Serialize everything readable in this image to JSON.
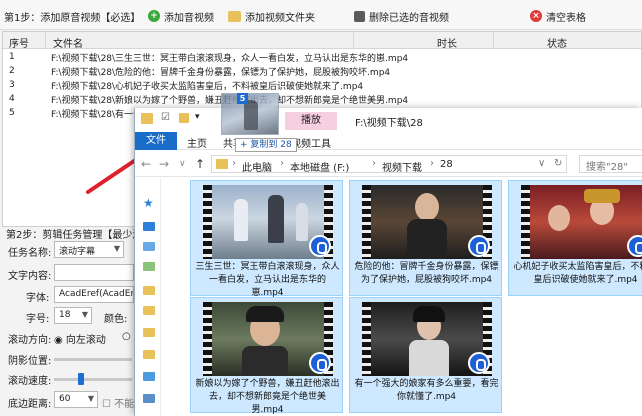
{
  "toolbar": {
    "step1": "第1步：添加原音视频【必选】",
    "add_video": "添加音视频",
    "add_folder": "添加视频文件夹",
    "delete_selected": "删除已选的音视频",
    "clear_table": "清空表格"
  },
  "table": {
    "columns": [
      "序号",
      "文件名",
      "时长",
      "状态"
    ],
    "rows": [
      {
        "no": "1",
        "file": "F:\\视频下载\\28\\三生三世：冥王带白滚滚现身，众人一看白发，立马认出是东华的崽.mp4"
      },
      {
        "no": "2",
        "file": "F:\\视频下载\\28\\危险的他：冒牌千金身份暴露，保镖为了保护她，屁股被狗咬坏.mp4"
      },
      {
        "no": "3",
        "file": "F:\\视频下载\\28\\心机妃子收买太监陷害皇后，不料被皇后识破使她就来了.mp4"
      },
      {
        "no": "4",
        "file": "F:\\视频下载\\28\\新娘以为嫁了个野兽，嫌丑赶他滚出去，却不想新郎竟是个绝世美男.mp4"
      },
      {
        "no": "5",
        "file": "F:\\视频下载\\28\\有一个强大的娘家有多么重要，看完你就懂了.mp4"
      }
    ]
  },
  "step2": {
    "title": "第2步：剪辑任务管理【最少添加",
    "task_name_label": "任务名称:",
    "task_name_value": "滚动字幕",
    "text_label": "文字内容:",
    "font_label": "字体:",
    "font_value": "AcadEref(AcadEref",
    "size_label": "字号:",
    "size_value": "18",
    "color_label": "颜色:",
    "direction_label": "滚动方向:",
    "direction_value": "向左滚动",
    "shadow_label": "阴影位置:",
    "speed_label": "滚动速度:",
    "bottom_label": "底边距离:",
    "bottom_value": "60",
    "cannot_exceed": "不能超"
  },
  "drag": {
    "count": "5",
    "copy_label": "+ 复制到 28"
  },
  "explorer": {
    "ribbon_tabs": [
      "文件",
      "主页",
      "共享",
      "查看"
    ],
    "context_tab": "播放",
    "context_sub": "视频工具",
    "title_path": "F:\\视频下载\\28",
    "breadcrumbs": [
      "此电脑",
      "本地磁盘 (F:)",
      "视频下载",
      "28"
    ],
    "search_placeholder": "搜索\"28\"",
    "files": [
      "三生三世：冥王带白滚滚现身，众人一看白发，立马认出是东华的崽.mp4",
      "危险的他：冒牌千金身份暴露，保镖为了保护她，屁股被狗咬坏.mp4",
      "心机妃子收买太监陷害皇后，不料被皇后识破使她就来了.mp4",
      "新娘以为嫁了个野兽，嫌丑赶他滚出去，却不想新郎竟是个绝世美男.mp4",
      "有一个强大的娘家有多么重要，看完你就懂了.mp4"
    ]
  },
  "colors": {
    "accent": "#1a6cc9",
    "selection": "#cde8ff",
    "context_tab": "#f6cfe0",
    "arrow": "#e0202a"
  }
}
